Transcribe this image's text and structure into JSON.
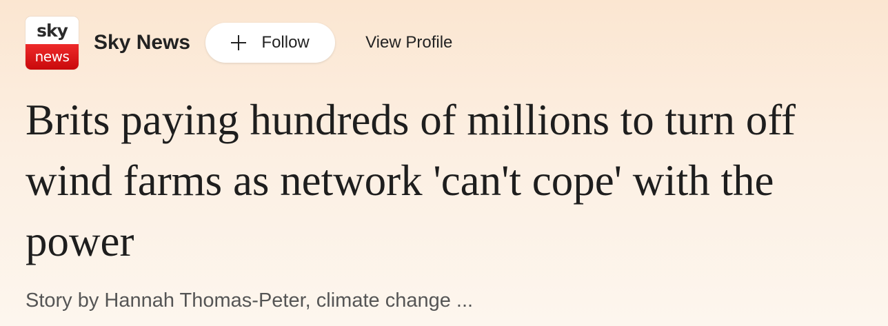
{
  "publisher": {
    "logo_top": "sky",
    "logo_bottom": "news",
    "name": "Sky News",
    "follow_label": "Follow",
    "view_profile_label": "View Profile"
  },
  "article": {
    "headline": "Brits paying hundreds of millions to turn off wind farms as network 'can't cope' with the power",
    "byline": "Story by Hannah Thomas-Peter, climate change ..."
  },
  "colors": {
    "logo_red": "#d91618",
    "background_top": "#fbe6d1",
    "background_bottom": "#fdf6ee"
  },
  "icons": {
    "follow": "plus-icon"
  }
}
